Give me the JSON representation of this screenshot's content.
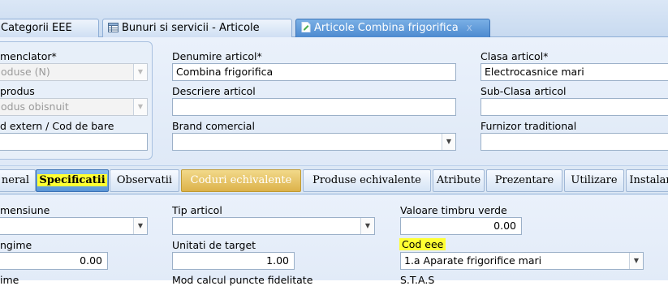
{
  "doc_tabs": [
    {
      "label": "Categorii EEE"
    },
    {
      "label": "Bunuri si servicii - Articole"
    },
    {
      "label": "Articole Combina frigorifica",
      "close": "x"
    }
  ],
  "left_group": {
    "nomenclator_label": "menclator*",
    "nomenclator_value": "oduse (N)",
    "tip_produs_label": "produs",
    "tip_produs_value": "odus obisnuit",
    "cod_extern_label": "d extern / Cod de bare",
    "cod_extern_value": ""
  },
  "form": {
    "denumire_label": "Denumire articol*",
    "denumire_value": "Combina frigorifica",
    "descriere_label": "Descriere articol",
    "descriere_value": "",
    "brand_label": "Brand comercial",
    "brand_value": "",
    "clasa_label": "Clasa articol*",
    "clasa_value": "Electrocasnice mari",
    "subclasa_label": "Sub-Clasa articol",
    "subclasa_value": "",
    "furnizor_label": "Furnizor traditional",
    "furnizor_value": ""
  },
  "detail_tabs": [
    {
      "label": "neral"
    },
    {
      "label": "Specificatii",
      "active": true
    },
    {
      "label": "Observatii"
    },
    {
      "label": "Coduri echivalente"
    },
    {
      "label": "Produse echivalente"
    },
    {
      "label": "Atribute"
    },
    {
      "label": "Prezentare"
    },
    {
      "label": "Utilizare"
    },
    {
      "label": "Instalar"
    }
  ],
  "spec": {
    "dimensiune_label": "mensiune",
    "dimensiune_value": "",
    "tip_articol_label": "Tip articol",
    "tip_articol_value": "",
    "timbru_label": "Valoare timbru verde",
    "timbru_value": "0.00",
    "lungime_label": "ngime",
    "lungime_value": "0.00",
    "unitati_label": "Unitati de target",
    "unitati_value": "1.00",
    "cod_eee_label": "Cod eee",
    "cod_eee_value": "1.a Aparate frigorifice mari",
    "row3_col1_label": "ime",
    "row3_col2_label": "Mod calcul puncte fidelitate",
    "row3_col3_label": "S.T.A.S"
  },
  "colors": {
    "highlight": "#ffff33",
    "active_tab": "#5a96d6",
    "gold_tab": "#dcb24a"
  }
}
